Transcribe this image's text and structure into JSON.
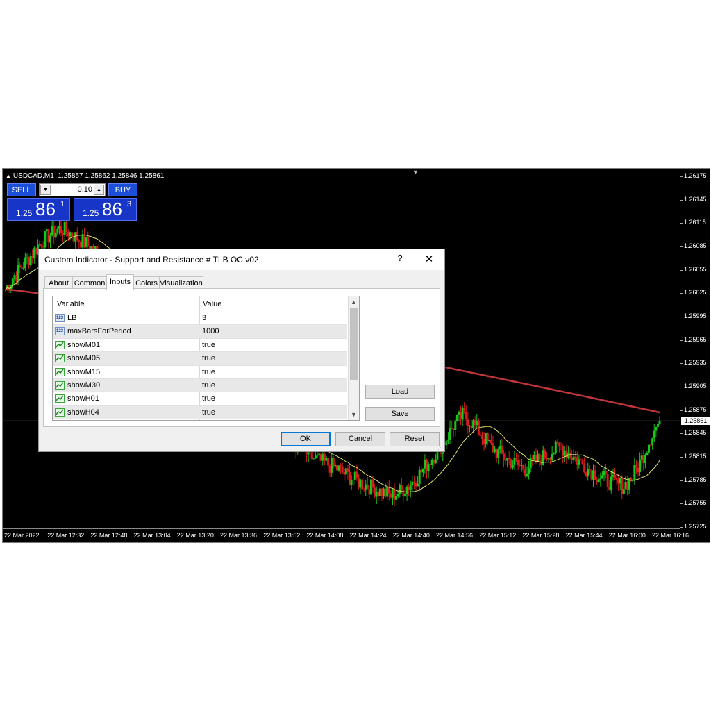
{
  "chart": {
    "header": {
      "symbol": "USDCAD,M1",
      "ohlc": "1.25857 1.25862 1.25846 1.25861"
    },
    "trade_panel": {
      "sell_label": "SELL",
      "buy_label": "BUY",
      "lot": "0.10",
      "sell_price": {
        "prefix": "1.25",
        "big": "86",
        "sup": "1"
      },
      "buy_price": {
        "prefix": "1.25",
        "big": "86",
        "sup": "3"
      }
    },
    "current_price": "1.25861",
    "colors": {
      "background": "#000000",
      "bull": "#19c719",
      "bear": "#d41c1c",
      "ma_fast": "#e6e36a",
      "ma_slow": "#c0353a"
    }
  },
  "chart_data": {
    "type": "candlestick",
    "y_ticks": [
      "1.26175",
      "1.26145",
      "1.26115",
      "1.26085",
      "1.26055",
      "1.26025",
      "1.25995",
      "1.25965",
      "1.25935",
      "1.25905",
      "1.25875",
      "1.25845",
      "1.25815",
      "1.25785",
      "1.25755",
      "1.25725"
    ],
    "ylim": [
      1.25725,
      1.26175
    ],
    "x_ticks": [
      "22 Mar 2022",
      "22 Mar 12:32",
      "22 Mar 12:48",
      "22 Mar 13:04",
      "22 Mar 13:20",
      "22 Mar 13:36",
      "22 Mar 13:52",
      "22 Mar 14:08",
      "22 Mar 14:24",
      "22 Mar 14:40",
      "22 Mar 14:56",
      "22 Mar 15:12",
      "22 Mar 15:28",
      "22 Mar 15:44",
      "22 Mar 16:00",
      "22 Mar 16:16"
    ],
    "close_series": [
      1.2603,
      1.26048,
      1.26062,
      1.26076,
      1.26092,
      1.261,
      1.26108,
      1.26104,
      1.26096,
      1.26088,
      1.2608,
      1.26072,
      1.2606,
      1.26045,
      1.2603,
      1.2601,
      1.2599,
      1.25975,
      1.25965,
      1.2595,
      1.2594,
      1.25935,
      1.25925,
      1.25912,
      1.259,
      1.2589,
      1.2588,
      1.2587,
      1.2586,
      1.2585,
      1.25845,
      1.2584,
      1.25832,
      1.25825,
      1.25815,
      1.2581,
      1.25805,
      1.258,
      1.25792,
      1.25785,
      1.2578,
      1.25775,
      1.2577,
      1.25765,
      1.2577,
      1.25778,
      1.2579,
      1.25805,
      1.2582,
      1.25835,
      1.25855,
      1.25868,
      1.2586,
      1.25845,
      1.2583,
      1.2582,
      1.25812,
      1.25805,
      1.258,
      1.25808,
      1.25815,
      1.25822,
      1.25828,
      1.25818,
      1.2581,
      1.258,
      1.25792,
      1.25785,
      1.2578,
      1.25778,
      1.2579,
      1.25812,
      1.2584,
      1.25861
    ]
  },
  "dialog": {
    "title": "Custom Indicator - Support and Resistance # TLB OC v02",
    "help": "?",
    "close": "✕",
    "tabs": [
      "About",
      "Common",
      "Inputs",
      "Colors",
      "Visualization"
    ],
    "active_tab": "Inputs",
    "columns": {
      "variable": "Variable",
      "value": "Value"
    },
    "rows": [
      {
        "icon": "numeric-icon",
        "variable": "LB",
        "value": "3"
      },
      {
        "icon": "numeric-icon",
        "variable": "maxBarsForPeriod",
        "value": "1000"
      },
      {
        "icon": "boolean-icon",
        "variable": "showM01",
        "value": "true"
      },
      {
        "icon": "boolean-icon",
        "variable": "showM05",
        "value": "true"
      },
      {
        "icon": "boolean-icon",
        "variable": "showM15",
        "value": "true"
      },
      {
        "icon": "boolean-icon",
        "variable": "showM30",
        "value": "true"
      },
      {
        "icon": "boolean-icon",
        "variable": "showH01",
        "value": "true"
      },
      {
        "icon": "boolean-icon",
        "variable": "showH04",
        "value": "true"
      }
    ],
    "numeric_icon_text": "123",
    "load_label": "Load",
    "save_label": "Save",
    "ok_label": "OK",
    "cancel_label": "Cancel",
    "reset_label": "Reset"
  }
}
